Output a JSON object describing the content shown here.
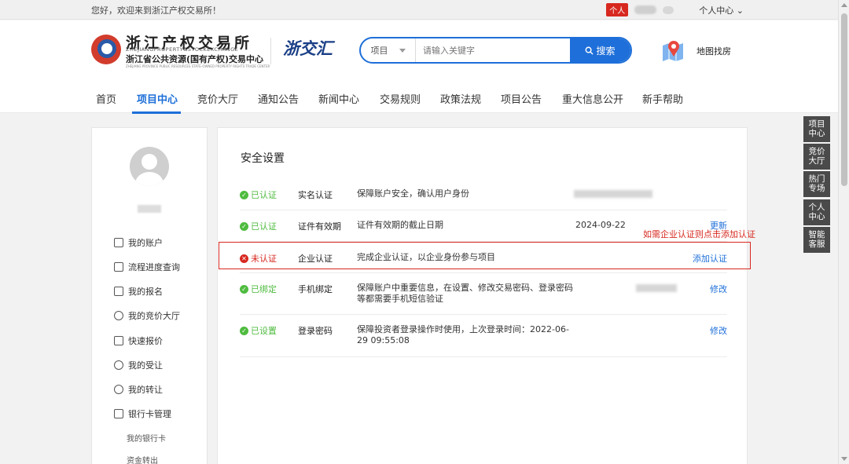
{
  "topbar": {
    "welcome": "您好，欢迎来到浙江产权交易所！",
    "personal_tag": "个人",
    "user_center": "个人中心"
  },
  "header": {
    "logo_cn": "浙江产权交易所",
    "logo_en": "ZHEJIANGPROPERTY&STOCKEXCHANGE",
    "logo_sub": "浙江省公共资源(国有产权)交易中心",
    "logo_tiny": "ZHEJIANG PROVINCE PUBLIC RESOURCES STATE-OWNED PROPERTY RIGHTS TRADE CENTER",
    "zjh": "浙交汇",
    "search_select": "项目",
    "search_placeholder": "请输入关键字",
    "search_button": "搜索",
    "map_label": "地图找房"
  },
  "nav": {
    "items": [
      "首页",
      "项目中心",
      "竞价大厅",
      "通知公告",
      "新闻中心",
      "交易规则",
      "政策法规",
      "项目公告",
      "重大信息公开",
      "新手帮助"
    ],
    "active_index": 1
  },
  "sidebar": {
    "menu": [
      "我的账户",
      "流程进度查询",
      "我的报名",
      "我的竞价大厅",
      "快速报价",
      "我的受让",
      "我的转让",
      "银行卡管理"
    ],
    "submenu": [
      "我的银行卡",
      "资金转出"
    ]
  },
  "security": {
    "title": "安全设置",
    "rows": [
      {
        "status": "已认证",
        "name": "实名认证",
        "desc": "保障账户安全，确认用户身份",
        "value": "",
        "action": ""
      },
      {
        "status": "已认证",
        "name": "证件有效期",
        "desc": "证件有效期的截止日期",
        "value": "2024-09-22",
        "action": "更新"
      },
      {
        "status": "未认证",
        "name": "企业认证",
        "desc": "完成企业认证，以企业身份参与项目",
        "value": "",
        "action": "添加认证"
      },
      {
        "status": "已绑定",
        "name": "手机绑定",
        "desc": "保障账户中重要信息，在设置、修改交易密码、登录密码等都需要手机短信验证",
        "value": "",
        "action": "修改"
      },
      {
        "status": "已设置",
        "name": "登录密码",
        "desc": "保障投资者登录操作时使用，上次登录时间：2022-06-29 09:55:08",
        "value": "",
        "action": "修改"
      }
    ]
  },
  "annotation": "如需企业认证则点击添加认证",
  "float_bar": [
    "项目中心",
    "竞价大厅",
    "热门专场",
    "个人中心",
    "智能客服"
  ],
  "colors": {
    "accent": "#1e6fd9",
    "success": "#4fbb3f",
    "danger": "#d7281f"
  }
}
